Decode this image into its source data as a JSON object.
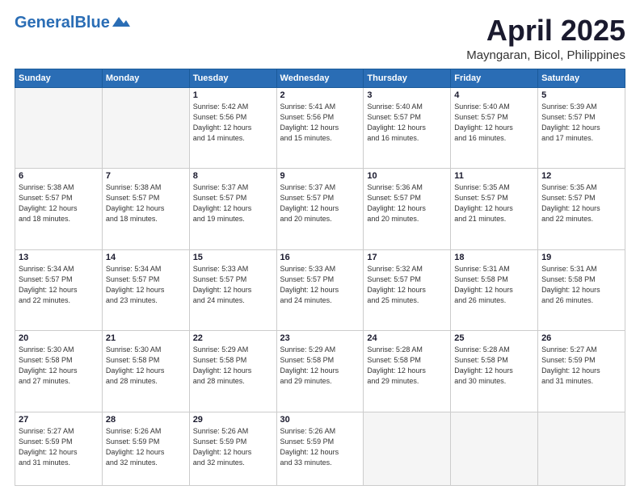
{
  "header": {
    "logo_general": "General",
    "logo_blue": "Blue",
    "main_title": "April 2025",
    "subtitle": "Mayngaran, Bicol, Philippines"
  },
  "calendar": {
    "headers": [
      "Sunday",
      "Monday",
      "Tuesday",
      "Wednesday",
      "Thursday",
      "Friday",
      "Saturday"
    ],
    "weeks": [
      [
        {
          "day": "",
          "empty": true,
          "lines": []
        },
        {
          "day": "",
          "empty": true,
          "lines": []
        },
        {
          "day": "1",
          "lines": [
            "Sunrise: 5:42 AM",
            "Sunset: 5:56 PM",
            "Daylight: 12 hours",
            "and 14 minutes."
          ]
        },
        {
          "day": "2",
          "lines": [
            "Sunrise: 5:41 AM",
            "Sunset: 5:56 PM",
            "Daylight: 12 hours",
            "and 15 minutes."
          ]
        },
        {
          "day": "3",
          "lines": [
            "Sunrise: 5:40 AM",
            "Sunset: 5:57 PM",
            "Daylight: 12 hours",
            "and 16 minutes."
          ]
        },
        {
          "day": "4",
          "lines": [
            "Sunrise: 5:40 AM",
            "Sunset: 5:57 PM",
            "Daylight: 12 hours",
            "and 16 minutes."
          ]
        },
        {
          "day": "5",
          "lines": [
            "Sunrise: 5:39 AM",
            "Sunset: 5:57 PM",
            "Daylight: 12 hours",
            "and 17 minutes."
          ]
        }
      ],
      [
        {
          "day": "6",
          "lines": [
            "Sunrise: 5:38 AM",
            "Sunset: 5:57 PM",
            "Daylight: 12 hours",
            "and 18 minutes."
          ]
        },
        {
          "day": "7",
          "lines": [
            "Sunrise: 5:38 AM",
            "Sunset: 5:57 PM",
            "Daylight: 12 hours",
            "and 18 minutes."
          ]
        },
        {
          "day": "8",
          "lines": [
            "Sunrise: 5:37 AM",
            "Sunset: 5:57 PM",
            "Daylight: 12 hours",
            "and 19 minutes."
          ]
        },
        {
          "day": "9",
          "lines": [
            "Sunrise: 5:37 AM",
            "Sunset: 5:57 PM",
            "Daylight: 12 hours",
            "and 20 minutes."
          ]
        },
        {
          "day": "10",
          "lines": [
            "Sunrise: 5:36 AM",
            "Sunset: 5:57 PM",
            "Daylight: 12 hours",
            "and 20 minutes."
          ]
        },
        {
          "day": "11",
          "lines": [
            "Sunrise: 5:35 AM",
            "Sunset: 5:57 PM",
            "Daylight: 12 hours",
            "and 21 minutes."
          ]
        },
        {
          "day": "12",
          "lines": [
            "Sunrise: 5:35 AM",
            "Sunset: 5:57 PM",
            "Daylight: 12 hours",
            "and 22 minutes."
          ]
        }
      ],
      [
        {
          "day": "13",
          "lines": [
            "Sunrise: 5:34 AM",
            "Sunset: 5:57 PM",
            "Daylight: 12 hours",
            "and 22 minutes."
          ]
        },
        {
          "day": "14",
          "lines": [
            "Sunrise: 5:34 AM",
            "Sunset: 5:57 PM",
            "Daylight: 12 hours",
            "and 23 minutes."
          ]
        },
        {
          "day": "15",
          "lines": [
            "Sunrise: 5:33 AM",
            "Sunset: 5:57 PM",
            "Daylight: 12 hours",
            "and 24 minutes."
          ]
        },
        {
          "day": "16",
          "lines": [
            "Sunrise: 5:33 AM",
            "Sunset: 5:57 PM",
            "Daylight: 12 hours",
            "and 24 minutes."
          ]
        },
        {
          "day": "17",
          "lines": [
            "Sunrise: 5:32 AM",
            "Sunset: 5:57 PM",
            "Daylight: 12 hours",
            "and 25 minutes."
          ]
        },
        {
          "day": "18",
          "lines": [
            "Sunrise: 5:31 AM",
            "Sunset: 5:58 PM",
            "Daylight: 12 hours",
            "and 26 minutes."
          ]
        },
        {
          "day": "19",
          "lines": [
            "Sunrise: 5:31 AM",
            "Sunset: 5:58 PM",
            "Daylight: 12 hours",
            "and 26 minutes."
          ]
        }
      ],
      [
        {
          "day": "20",
          "lines": [
            "Sunrise: 5:30 AM",
            "Sunset: 5:58 PM",
            "Daylight: 12 hours",
            "and 27 minutes."
          ]
        },
        {
          "day": "21",
          "lines": [
            "Sunrise: 5:30 AM",
            "Sunset: 5:58 PM",
            "Daylight: 12 hours",
            "and 28 minutes."
          ]
        },
        {
          "day": "22",
          "lines": [
            "Sunrise: 5:29 AM",
            "Sunset: 5:58 PM",
            "Daylight: 12 hours",
            "and 28 minutes."
          ]
        },
        {
          "day": "23",
          "lines": [
            "Sunrise: 5:29 AM",
            "Sunset: 5:58 PM",
            "Daylight: 12 hours",
            "and 29 minutes."
          ]
        },
        {
          "day": "24",
          "lines": [
            "Sunrise: 5:28 AM",
            "Sunset: 5:58 PM",
            "Daylight: 12 hours",
            "and 29 minutes."
          ]
        },
        {
          "day": "25",
          "lines": [
            "Sunrise: 5:28 AM",
            "Sunset: 5:58 PM",
            "Daylight: 12 hours",
            "and 30 minutes."
          ]
        },
        {
          "day": "26",
          "lines": [
            "Sunrise: 5:27 AM",
            "Sunset: 5:59 PM",
            "Daylight: 12 hours",
            "and 31 minutes."
          ]
        }
      ],
      [
        {
          "day": "27",
          "lines": [
            "Sunrise: 5:27 AM",
            "Sunset: 5:59 PM",
            "Daylight: 12 hours",
            "and 31 minutes."
          ]
        },
        {
          "day": "28",
          "lines": [
            "Sunrise: 5:26 AM",
            "Sunset: 5:59 PM",
            "Daylight: 12 hours",
            "and 32 minutes."
          ]
        },
        {
          "day": "29",
          "lines": [
            "Sunrise: 5:26 AM",
            "Sunset: 5:59 PM",
            "Daylight: 12 hours",
            "and 32 minutes."
          ]
        },
        {
          "day": "30",
          "lines": [
            "Sunrise: 5:26 AM",
            "Sunset: 5:59 PM",
            "Daylight: 12 hours",
            "and 33 minutes."
          ]
        },
        {
          "day": "",
          "empty": true,
          "lines": []
        },
        {
          "day": "",
          "empty": true,
          "lines": []
        },
        {
          "day": "",
          "empty": true,
          "lines": []
        }
      ]
    ]
  }
}
